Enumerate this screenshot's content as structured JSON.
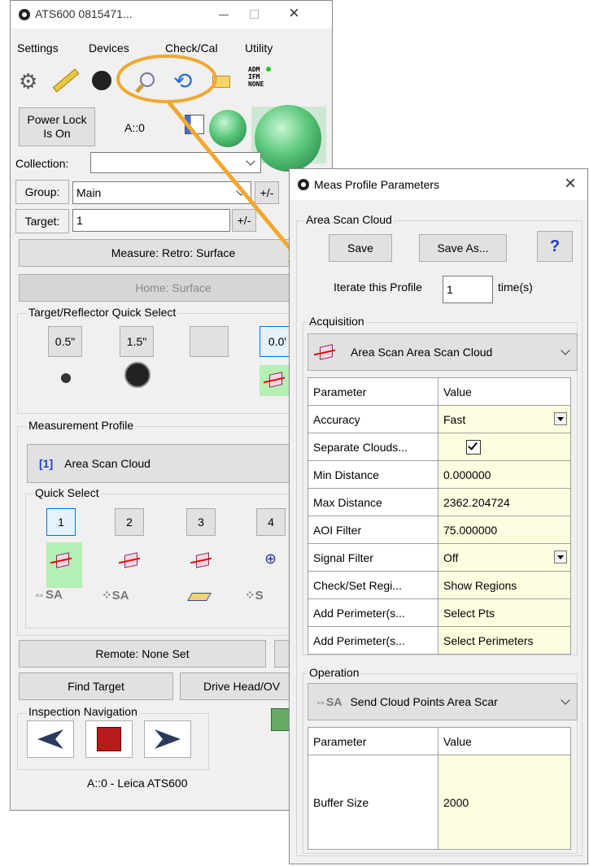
{
  "main_window": {
    "title": "ATS600 0815471...",
    "menu": [
      "Settings",
      "Devices",
      "Check/Cal",
      "Utility"
    ],
    "status_lines": [
      "ADM",
      "IFM",
      "NONE"
    ],
    "power_lock": "Power Lock\nIs On",
    "instrument_id": "A::0",
    "collection_label": "Collection:",
    "collection_value": "",
    "group_label": "Group:",
    "group_value": "Main",
    "plus_minus": "+/-",
    "target_label": "Target:",
    "target_value": "1",
    "measure_btn": "Measure: Retro: Surface",
    "home_btn": "Home: Surface",
    "target_quick_select": {
      "title": "Target/Reflector Quick Select",
      "buttons": [
        "0.5\"",
        "1.5\"",
        "",
        "0.0'"
      ]
    },
    "measurement_profile": {
      "title": "Measurement Profile",
      "index": "[1]",
      "name": "Area Scan Cloud"
    },
    "quick_select": {
      "title": "Quick Select",
      "buttons": [
        "1",
        "2",
        "3",
        "4"
      ]
    },
    "remote_btn": "Remote: None Set",
    "find_target_btn": "Find Target",
    "drive_head_btn": "Drive Head/OV",
    "inspection_nav_title": "Inspection Navigation",
    "footer": "A::0 - Leica ATS600"
  },
  "dialog": {
    "title": "Meas Profile Parameters",
    "profile_group": "Area Scan Cloud",
    "save": "Save",
    "save_as": "Save As...",
    "help": "?",
    "iterate_label": "Iterate this Profile",
    "iterate_value": "1",
    "iterate_unit": "time(s)",
    "acquisition_title": "Acquisition",
    "acquisition_select": "Area Scan Area Scan Cloud",
    "params_header": [
      "Parameter",
      "Value"
    ],
    "params": [
      {
        "name": "Accuracy",
        "value": "Fast"
      },
      {
        "name": "Separate Clouds...",
        "value": ""
      },
      {
        "name": "Min Distance",
        "value": "0.000000"
      },
      {
        "name": "Max Distance",
        "value": "2362.204724"
      },
      {
        "name": "AOI Filter",
        "value": "75.000000"
      },
      {
        "name": "Signal Filter",
        "value": "Off"
      },
      {
        "name": "Check/Set Regi...",
        "value": "Show Regions"
      },
      {
        "name": "Add Perimeter(s...",
        "value": "Select Pts"
      },
      {
        "name": "Add Perimeter(s...",
        "value": "Select Perimeters"
      }
    ],
    "operation_title": "Operation",
    "operation_select": "Send Cloud Points Area Scar",
    "op_header": [
      "Parameter",
      "Value"
    ],
    "op_params": [
      {
        "name": "Buffer Size",
        "value": "2000"
      }
    ]
  },
  "colors": {
    "callout": "#f0a830",
    "accent_blue": "#0078d7",
    "value_bg": "#fffde0"
  }
}
